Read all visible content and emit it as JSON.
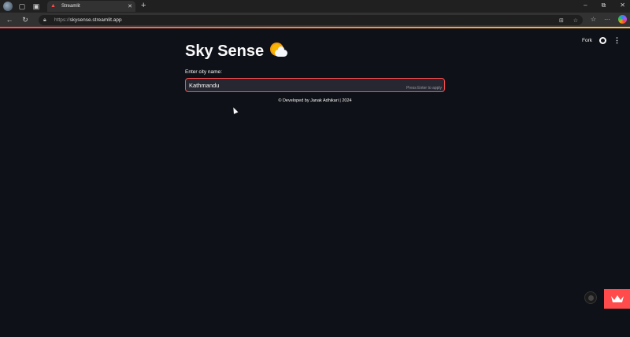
{
  "browser": {
    "tab_title": "Streamlit",
    "url_scheme": "https://",
    "url_host": "skysense.streamlit.app",
    "tab_close": "✕",
    "new_tab": "+",
    "window_controls": [
      "–",
      "⧉",
      "✕"
    ]
  },
  "app": {
    "toolbar": {
      "fork_label": "Fork"
    },
    "title": "Sky Sense",
    "title_emoji": "sun-behind-cloud",
    "city_input": {
      "label": "Enter city name:",
      "value": "Kathmandu",
      "hint": "Press Enter to apply"
    },
    "footer": "© Developed by Janak Adhikari | 2024"
  },
  "colors": {
    "background": "#0e1117",
    "accent": "#ff4b4b",
    "input_bg": "#262730",
    "text": "#fafafa"
  },
  "icons": [
    "profile-avatar-icon",
    "workspaces-icon",
    "tab-actions-icon",
    "streamlit-favicon-icon",
    "back-icon",
    "refresh-icon",
    "lock-icon",
    "read-mode-icon",
    "favorite-star-icon",
    "favorites-icon",
    "more-icon",
    "copilot-icon",
    "github-icon",
    "kebab-menu-icon",
    "crown-icon"
  ]
}
